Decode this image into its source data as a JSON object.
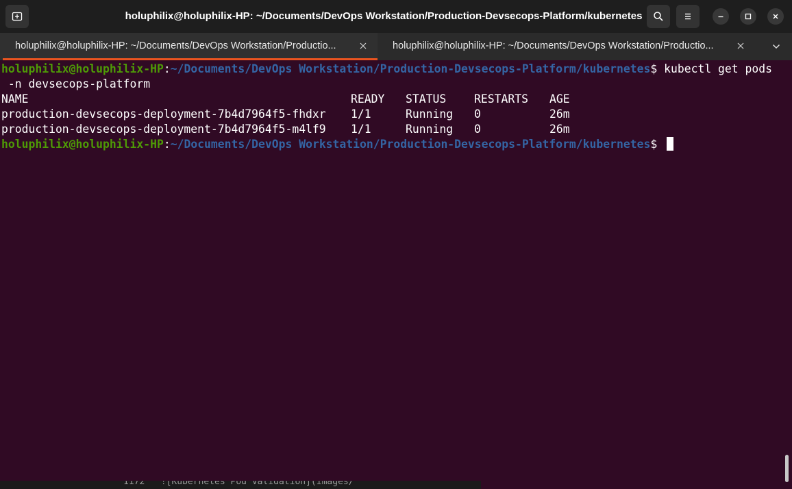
{
  "window": {
    "title": "holuphilix@holuphilix-HP: ~/Documents/DevOps Workstation/Production-Devsecops-Platform/kubernetes",
    "buttons": {
      "new_tab_icon": "new-tab-icon",
      "search_icon": "search-icon",
      "menu_icon": "hamburger-menu-icon",
      "minimize_icon": "minimize-icon",
      "maximize_icon": "maximize-icon",
      "close_icon": "close-icon"
    }
  },
  "tabs": [
    {
      "label": "holuphilix@holuphilix-HP: ~/Documents/DevOps Workstation/Productio...",
      "active": true
    },
    {
      "label": "holuphilix@holuphilix-HP: ~/Documents/DevOps Workstation/Productio...",
      "active": false
    }
  ],
  "tab_overflow_icon": "chevron-down-icon",
  "terminal": {
    "prompt": {
      "user_host": "holuphilix@holuphilix-HP",
      "separator": ":",
      "path": "~/Documents/DevOps Workstation/Production-Devsecops-Platform/kubernetes",
      "symbol": "$ "
    },
    "command_line_1": "kubectl get pods",
    "command_line_2": " -n devsecops-platform",
    "table": {
      "headers": [
        "NAME",
        "READY",
        "STATUS",
        "RESTARTS",
        "AGE"
      ],
      "rows": [
        [
          "production-devsecops-deployment-7b4d7964f5-fhdxr",
          "1/1",
          "Running",
          "0",
          "26m"
        ],
        [
          "production-devsecops-deployment-7b4d7964f5-m4lf9",
          "1/1",
          "Running",
          "0",
          "26m"
        ]
      ]
    }
  },
  "background_window_text": "1172   ![Kubernetes Pod Validation](images/",
  "colors": {
    "terminal_bg": "#300a24",
    "prompt_user": "#4e9a06",
    "prompt_path": "#3465a4",
    "active_tab_accent": "#e95420"
  }
}
